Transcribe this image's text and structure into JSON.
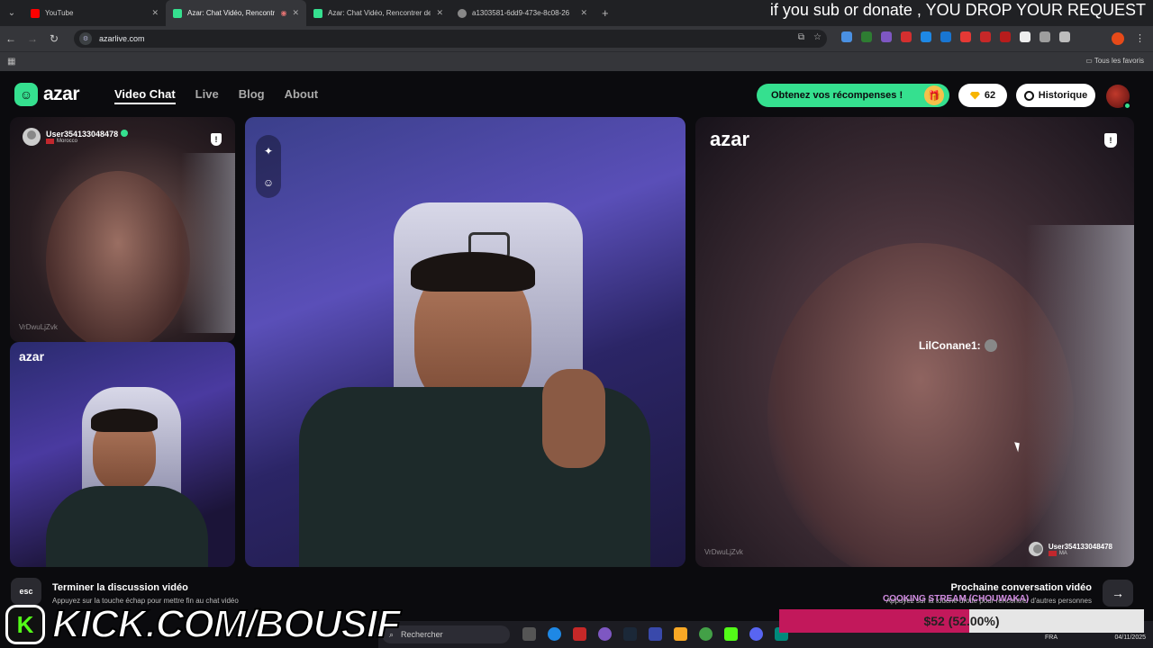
{
  "browser": {
    "tabs": [
      {
        "title": "YouTube",
        "fav_color": "#ff0000",
        "active": false
      },
      {
        "title": "Azar: Chat Vidéo, Rencontre",
        "fav_color": "#35e08f",
        "active": true
      },
      {
        "title": "Azar: Chat Vidéo, Rencontrer de",
        "fav_color": "#35e08f",
        "active": false
      },
      {
        "title": "a1303581-6dd9-473e-8c08-26",
        "fav_color": "#888888",
        "active": false
      }
    ],
    "url": "azarlive.com",
    "bookmarks_all": "Tous les favoris"
  },
  "stream_overlay": {
    "request_text": "if you sub or donate , YOU DROP YOUR REQUEST",
    "kick_text": "KICK.COM/BOUSIF",
    "cooking_text": "COOKING STREAM (CHOUWAKA)",
    "donation_text": "$52 (52.00%)",
    "donation_progress": 0.52
  },
  "azar": {
    "logo": "azar",
    "nav": [
      "Video Chat",
      "Live",
      "Blog",
      "About"
    ],
    "rewards_label": "Obtenez vos récompenses !",
    "gems_count": "62",
    "history_label": "Historique",
    "partner_user": "User354133048478",
    "partner_country": "Morocco",
    "partner_country_code": "MA",
    "watermark": "VrDwuLjZvk",
    "brand_small": "azar",
    "chat_message_user": "LilConane1:",
    "end_title": "Terminer la discussion vidéo",
    "end_sub": "Appuyez sur la touche échap pour mettre fin au chat vidéo",
    "esc_label": "esc",
    "next_title": "Prochaine conversation vidéo",
    "next_sub": "Appuyez sur la touche droite pour rencontrer d'autres personnes"
  },
  "taskbar": {
    "search_placeholder": "Rechercher",
    "lang": "FRA",
    "date": "04/11/2025"
  }
}
